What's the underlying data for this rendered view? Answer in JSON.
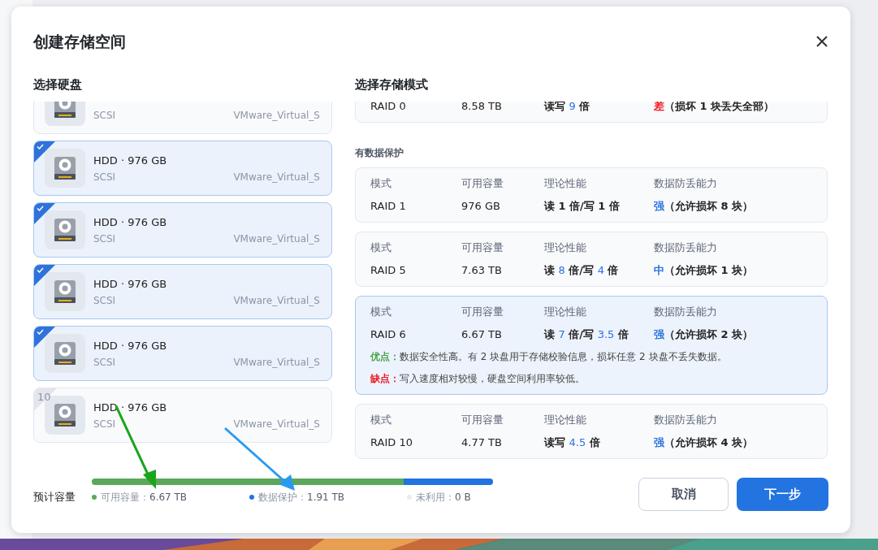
{
  "dialog": {
    "title": "创建存储空间"
  },
  "disk_section": {
    "title": "选择硬盘",
    "disks": [
      {
        "subtitle": "SCSI",
        "model": "VMware_Virtual_S"
      },
      {
        "title": "HDD · 976 GB",
        "subtitle": "SCSI",
        "model": "VMware_Virtual_S",
        "checked": true
      },
      {
        "title": "HDD · 976 GB",
        "subtitle": "SCSI",
        "model": "VMware_Virtual_S",
        "checked": true
      },
      {
        "title": "HDD · 976 GB",
        "subtitle": "SCSI",
        "model": "VMware_Virtual_S",
        "checked": true
      },
      {
        "title": "HDD · 976 GB",
        "subtitle": "SCSI",
        "model": "VMware_Virtual_S",
        "checked": true
      },
      {
        "title": "HDD · 976 GB",
        "subtitle": "SCSI",
        "model": "VMware_Virtual_S",
        "checked": false,
        "index": "10"
      }
    ]
  },
  "mode_section": {
    "title": "选择存储模式",
    "groups": [
      {
        "modes": [
          {
            "mode": "RAID 0",
            "capacity": "8.58 TB",
            "performance": [
              {
                "text": "读写 ",
                "highlight": false
              },
              {
                "text": "9",
                "highlight": true
              },
              {
                "text": " 倍",
                "highlight": false
              }
            ],
            "rating": {
              "text": "差",
              "color": "#f0141e"
            },
            "rating_note": "（损坏 1 块丢失全部）",
            "selected": false
          }
        ]
      },
      {
        "label": "有数据保护",
        "modes": [
          {
            "labels": [
              "模式",
              "可用容量",
              "理论性能",
              "数据防丢能力"
            ],
            "mode": "RAID 1",
            "capacity": "976 GB",
            "performance": [
              {
                "text": "读 1 倍/写 1 倍",
                "highlight": false
              }
            ],
            "rating": {
              "text": "强",
              "color": "#2a72de"
            },
            "rating_note": "（允许损坏 8 块）",
            "selected": false
          },
          {
            "labels": [
              "模式",
              "可用容量",
              "理论性能",
              "数据防丢能力"
            ],
            "mode": "RAID 5",
            "capacity": "7.63 TB",
            "performance": [
              {
                "text": "读 ",
                "highlight": false
              },
              {
                "text": "8",
                "highlight": true
              },
              {
                "text": " 倍/写 ",
                "highlight": false
              },
              {
                "text": "4",
                "highlight": true
              },
              {
                "text": " 倍",
                "highlight": false
              }
            ],
            "rating": {
              "text": "中",
              "color": "#2a72de"
            },
            "rating_note": "（允许损坏 1 块）",
            "selected": false
          },
          {
            "labels": [
              "模式",
              "可用容量",
              "理论性能",
              "数据防丢能力"
            ],
            "mode": "RAID 6",
            "capacity": "6.67 TB",
            "performance": [
              {
                "text": "读 ",
                "highlight": false
              },
              {
                "text": "7",
                "highlight": true
              },
              {
                "text": " 倍/写 ",
                "highlight": false
              },
              {
                "text": "3.5",
                "highlight": true
              },
              {
                "text": " 倍",
                "highlight": false
              }
            ],
            "rating": {
              "text": "强",
              "color": "#2a72de"
            },
            "rating_note": "（允许损坏 2 块）",
            "selected": true,
            "notes": [
              {
                "kind": "pro",
                "label": "优点：",
                "text": "数据安全性高。有 2 块盘用于存储校验信息，损坏任意 2 块盘不丢失数据。"
              },
              {
                "kind": "con",
                "label": "缺点：",
                "text": "写入速度相对较慢，硬盘空间利用率较低。"
              }
            ]
          },
          {
            "labels": [
              "模式",
              "可用容量",
              "理论性能",
              "数据防丢能力"
            ],
            "mode": "RAID 10",
            "capacity": "4.77 TB",
            "performance": [
              {
                "text": "读写 ",
                "highlight": false
              },
              {
                "text": "4.5",
                "highlight": true
              },
              {
                "text": " 倍",
                "highlight": false
              }
            ],
            "rating": {
              "text": "强",
              "color": "#2a72de"
            },
            "rating_note": "（允许损坏 4 块）",
            "selected": false
          }
        ]
      }
    ]
  },
  "capacity": {
    "label": "预计容量",
    "bar": [
      {
        "color": "#5ba85a",
        "level": 0.777
      },
      {
        "color": "#2272e0",
        "level": 0.223
      }
    ],
    "legend": [
      {
        "label": "可用容量：",
        "value": "6.67 TB",
        "color": "#5ba85a"
      },
      {
        "label": "数据保护：",
        "value": "1.91 TB",
        "color": "#2272e0"
      },
      {
        "label": "未利用：",
        "value": "0 B",
        "color": "#e8ebf0"
      }
    ]
  },
  "buttons": {
    "cancel": "取消",
    "next": "下一步"
  }
}
